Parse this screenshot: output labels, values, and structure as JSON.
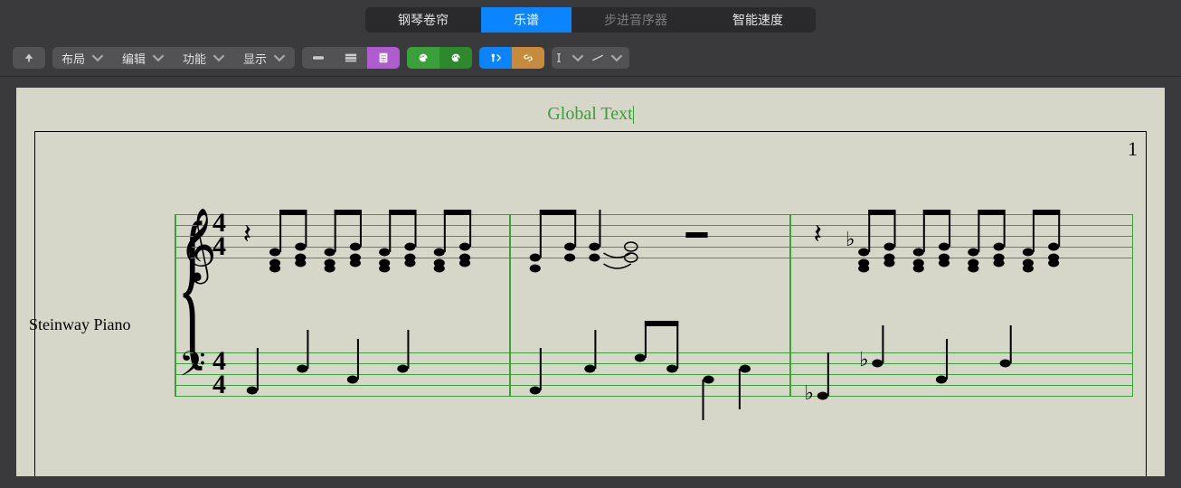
{
  "tabs": {
    "piano_roll": "钢琴卷帘",
    "score": "乐谱",
    "step_sequencer": "步进音序器",
    "smart_tempo": "智能速度"
  },
  "toolbar": {
    "layout": "布局",
    "edit": "编辑",
    "functions": "功能",
    "view": "显示"
  },
  "score": {
    "global_text": "Global Text",
    "page_number": "1",
    "instrument": "Steinway Piano",
    "time_signature_top": "4",
    "time_signature_bottom": "4"
  },
  "icon_buttons": {
    "collapse": "collapse-icon",
    "linear": "linear-view-icon",
    "wrapped": "wrapped-view-icon",
    "page": "page-view-icon",
    "palette": "color-palette-icon",
    "palette2": "color-palette-2-icon",
    "midi_in": "midi-in-icon",
    "link": "link-icon",
    "text_tool": "text-tool-icon",
    "line_tool": "line-tool-icon"
  }
}
